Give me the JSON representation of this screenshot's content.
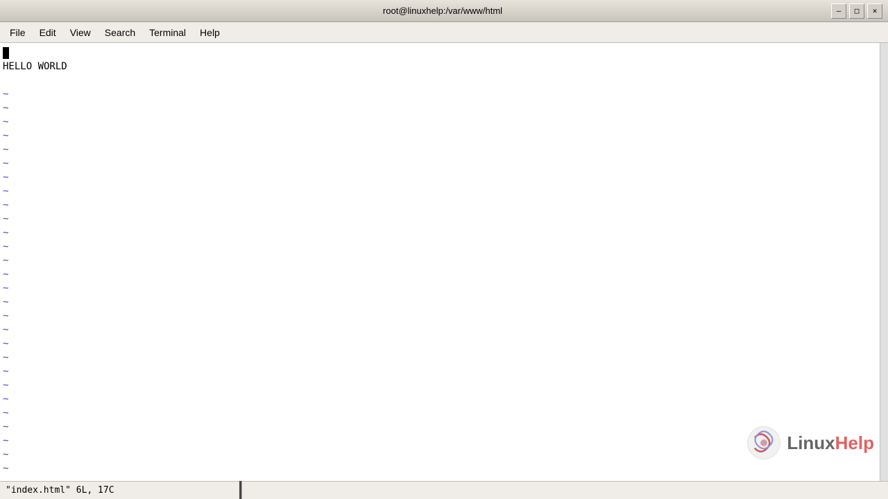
{
  "titlebar": {
    "title": "root@linuxhelp:/var/www/html",
    "minimize_label": "—",
    "maximize_label": "□",
    "close_label": "✕"
  },
  "menubar": {
    "items": [
      {
        "label": "File"
      },
      {
        "label": "Edit"
      },
      {
        "label": "View"
      },
      {
        "label": "Search"
      },
      {
        "label": "Terminal"
      },
      {
        "label": "Help"
      }
    ]
  },
  "editor": {
    "lines": [
      {
        "type": "cursor",
        "content": ""
      },
      {
        "type": "text",
        "content": "HELLO WORLD"
      },
      {
        "type": "empty",
        "content": ""
      },
      {
        "type": "tilde"
      },
      {
        "type": "tilde"
      },
      {
        "type": "tilde"
      },
      {
        "type": "tilde"
      },
      {
        "type": "tilde"
      },
      {
        "type": "tilde"
      },
      {
        "type": "tilde"
      },
      {
        "type": "tilde"
      },
      {
        "type": "tilde"
      },
      {
        "type": "tilde"
      },
      {
        "type": "tilde"
      },
      {
        "type": "tilde"
      },
      {
        "type": "tilde"
      },
      {
        "type": "tilde"
      },
      {
        "type": "tilde"
      },
      {
        "type": "tilde"
      },
      {
        "type": "tilde"
      },
      {
        "type": "tilde"
      },
      {
        "type": "tilde"
      },
      {
        "type": "tilde"
      },
      {
        "type": "tilde"
      },
      {
        "type": "tilde"
      },
      {
        "type": "tilde"
      },
      {
        "type": "tilde"
      },
      {
        "type": "tilde"
      },
      {
        "type": "tilde"
      },
      {
        "type": "tilde"
      }
    ]
  },
  "statusbar": {
    "text": "\"index.html\" 6L, 17C"
  },
  "watermark": {
    "text_before": "Linux",
    "text_after": "Help"
  }
}
